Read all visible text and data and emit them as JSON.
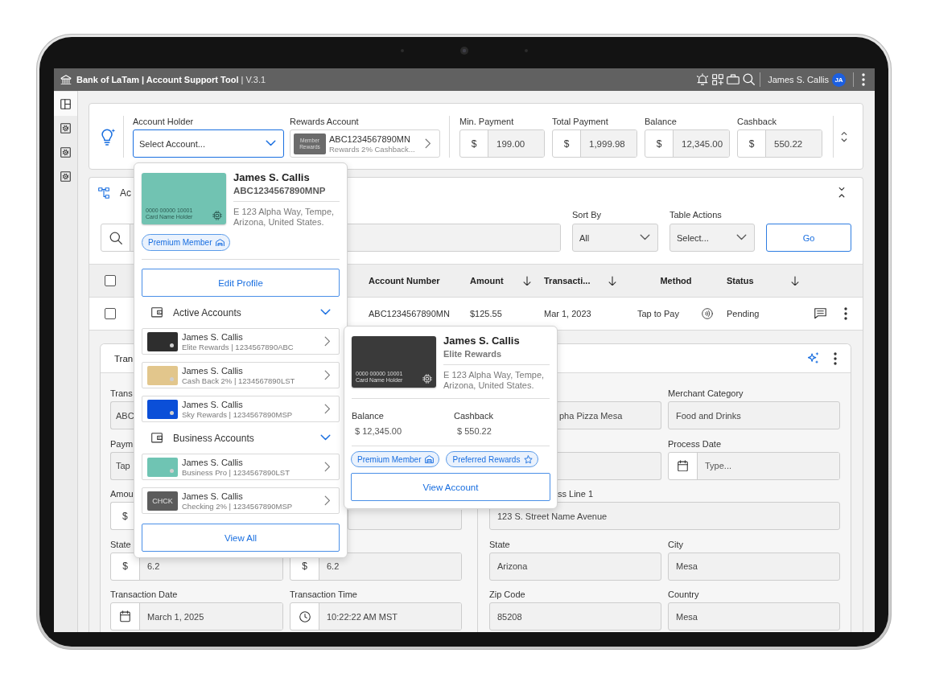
{
  "app_bar": {
    "title": "**Bank of LaTam | Account Support Tool** | V.3.1",
    "user_name": "James S. Callis",
    "avatar_initials": "JA"
  },
  "side_rail": {
    "items": [
      {
        "kind": "layout",
        "selected": true
      },
      {
        "kind": "settings",
        "selected": false
      },
      {
        "kind": "settings",
        "selected": false
      },
      {
        "kind": "settings",
        "selected": false
      }
    ]
  },
  "summary": {
    "account_holder": {
      "label": "Account Holder",
      "placeholder": "Select Account...",
      "expanded": true
    },
    "rewards_account": {
      "label": "Rewards Account",
      "tile": "Member Rewards",
      "number": "ABC1234567890MN",
      "description": "Rewards 2% Cashback..."
    },
    "amounts": [
      {
        "label": "Min. Payment",
        "currency": "$",
        "value": "199.00"
      },
      {
        "label": "Total Payment",
        "currency": "$",
        "value": "1,999.98"
      },
      {
        "label": "Balance",
        "currency": "$",
        "value": "12,345.00"
      },
      {
        "label": "Cashback",
        "currency": "$",
        "value": "550.22"
      }
    ]
  },
  "transactions": {
    "title": "Ac",
    "sort_by": {
      "label": "Sort By",
      "value": "All"
    },
    "table_actions": {
      "label": "Table Actions",
      "placeholder": "Select..."
    },
    "go_button": "Go",
    "table": {
      "select_all_checked": false,
      "columns": [
        {
          "label": "Account Number",
          "sortable": false
        },
        {
          "label": "Amount",
          "sortable": true
        },
        {
          "label": "Transacti...",
          "sortable": true
        },
        {
          "label": "Method",
          "sortable": false
        },
        {
          "label": "Status",
          "sortable": true
        }
      ],
      "rows": [
        {
          "checked": false,
          "cells": [
            "ABC1234567890MN",
            "$125.55",
            "Mar 1, 2023",
            "Tap to Pay",
            "Pending"
          ]
        }
      ]
    },
    "details": {
      "tabs": [
        {
          "label": "Tran",
          "selected": true
        }
      ],
      "left_rows": [
        {
          "fields": [
            {
              "kind": "text",
              "label": "Trans",
              "value": "ABC"
            }
          ]
        },
        {
          "fields": [
            {
              "kind": "text",
              "label": "Paym",
              "value": "Tap"
            }
          ]
        },
        {
          "fields": [
            {
              "kind": "currency",
              "label": "Amou",
              "currency": "$"
            },
            {
              "kind": "text"
            }
          ]
        },
        {
          "fields": [
            {
              "kind": "currency",
              "label": "State",
              "currency": "$",
              "value": "6.2"
            },
            {
              "kind": "currency",
              "currency": "$",
              "value": "6.2"
            }
          ]
        },
        {
          "fields": [
            {
              "kind": "date",
              "label": "Transaction Date",
              "value": "March 1, 2025"
            },
            {
              "kind": "time",
              "label": "Transaction Time",
              "value": "10:22:22 AM MST"
            }
          ]
        }
      ],
      "right_rows": [
        {
          "fields": [
            {
              "kind": "text",
              "value": "pha Pizza Mesa"
            },
            {
              "kind": "text",
              "label": "Merchant Category",
              "value": "Food and Drinks"
            }
          ]
        },
        {
          "fields": [
            {
              "kind": "text"
            },
            {
              "kind": "date",
              "label": "Process Date",
              "placeholder": "Type..."
            }
          ]
        },
        {
          "fields": [
            {
              "kind": "text",
              "label": "ss Line 1",
              "value": "123 S. Street Name Avenue"
            }
          ]
        },
        {
          "fields": [
            {
              "kind": "text",
              "label": "State",
              "value": "Arizona"
            },
            {
              "kind": "text",
              "label": "City",
              "value": "Mesa"
            }
          ]
        },
        {
          "fields": [
            {
              "kind": "text",
              "label": "Zip Code",
              "value": "85208"
            },
            {
              "kind": "text",
              "label": "Country",
              "value": "Mesa"
            }
          ]
        }
      ]
    }
  },
  "account_menu": {
    "card": {
      "number": "0000 00000 10001",
      "holder": "Card Name Holder"
    },
    "name": "James S. Callis",
    "account": "ABC1234567890MNP",
    "address": "E 123 Alpha Way, Tempe, Arizona, United States.",
    "badges": [
      {
        "kind": "member",
        "label": "Premium Member"
      }
    ],
    "edit_button": "Edit Profile",
    "sections": [
      {
        "title": "Active Accounts",
        "expanded": true,
        "accounts": [
          {
            "kind": "card",
            "color": "#2e2e2e",
            "name": "James S. Callis",
            "detail": "Elite Rewards | 1234567890ABC"
          },
          {
            "kind": "card",
            "color": "#e2c68c",
            "name": "James S. Callis",
            "detail": "Cash Back 2% | 1234567890LST"
          },
          {
            "kind": "card",
            "color": "#0b4fd8",
            "name": "James S. Callis",
            "detail": "Sky Rewards | 1234567890MSP"
          }
        ]
      },
      {
        "title": "Business Accounts",
        "expanded": true,
        "accounts": [
          {
            "kind": "card",
            "color": "#6fc4b3",
            "name": "James S. Callis",
            "detail": "Business Pro | 1234567890LST"
          },
          {
            "kind": "tile",
            "color": "#5c5c5c",
            "tile": "CHCK",
            "name": "James S. Callis",
            "detail": "Checking 2% | 1234567890MSP"
          }
        ]
      }
    ],
    "view_all_button": "View All"
  },
  "account_preview": {
    "card": {
      "number": "0000 00000 10001",
      "holder": "Card Name Holder"
    },
    "name": "James S. Callis",
    "plan": "Elite Rewards",
    "address": "E 123 Alpha Way, Tempe, Arizona, United States.",
    "stats": [
      {
        "label": "Balance",
        "value": "$ 12,345.00"
      },
      {
        "label": "Cashback",
        "value": "$ 550.22"
      }
    ],
    "badges": [
      {
        "kind": "member",
        "label": "Premium Member"
      },
      {
        "kind": "rewards",
        "label": "Preferred Rewards"
      }
    ],
    "view_button": "View Account"
  }
}
